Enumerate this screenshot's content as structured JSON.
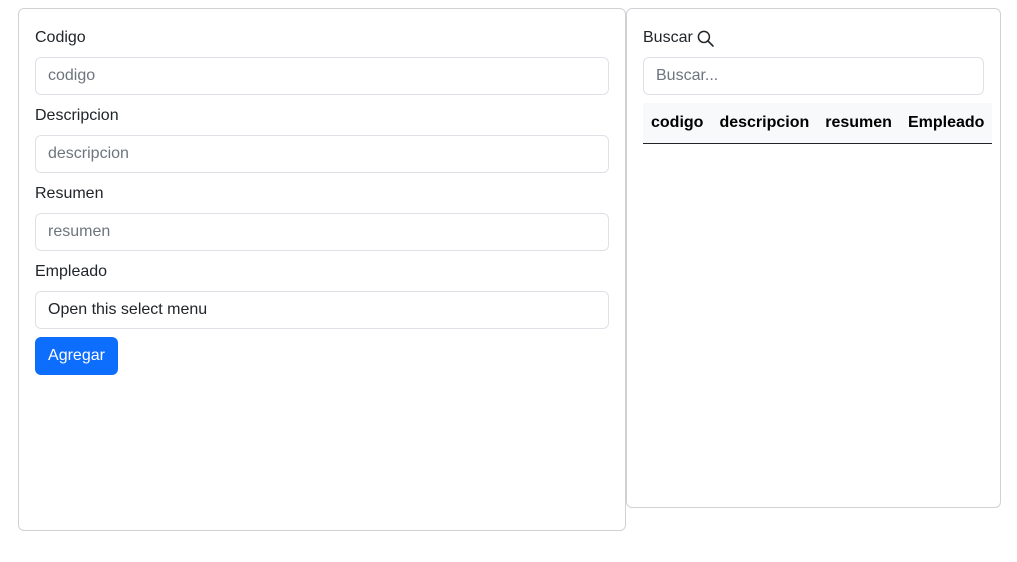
{
  "form": {
    "codigo": {
      "label": "Codigo",
      "placeholder": "codigo"
    },
    "descripcion": {
      "label": "Descripcion",
      "placeholder": "descripcion"
    },
    "resumen": {
      "label": "Resumen",
      "placeholder": "resumen"
    },
    "empleado": {
      "label": "Empleado",
      "selected": "Open this select menu"
    },
    "submit_label": "Agregar"
  },
  "search": {
    "label": "Buscar",
    "icon": "search-icon",
    "placeholder": "Buscar..."
  },
  "table": {
    "columns": [
      "codigo",
      "descripcion",
      "resumen",
      "Empleado"
    ],
    "rows": []
  },
  "colors": {
    "primary": "#0d6efd",
    "border": "#dee2e6",
    "header_bg": "#f8f9fa"
  }
}
